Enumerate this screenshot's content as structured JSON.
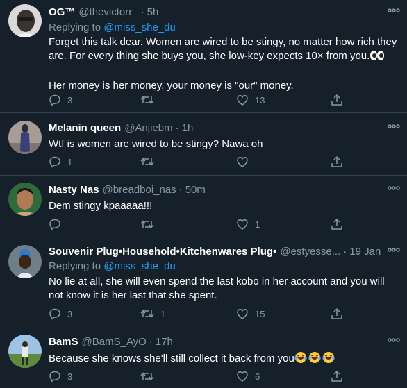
{
  "colors": {
    "background": "#15202b",
    "divider": "#38444d",
    "secondary_text": "#8899a6",
    "link": "#1da1f2",
    "primary_text": "#ffffff"
  },
  "tweets": [
    {
      "name": "OG™",
      "handle": "@thevictorr_",
      "separator": "·",
      "time": "5h",
      "replying_label": "Replying to",
      "replying_to": "@miss_she_du",
      "text": "Forget this talk dear. Women are wired to be stingy, no matter how rich they are. For every thing she buys you, she low-key expects 10× from you.",
      "text_emoji": "eyes-emoji",
      "text2": "Her money is her money, your money is \"our\" money.",
      "replies": "3",
      "retweets": "",
      "likes": "13"
    },
    {
      "name": "Melanin queen",
      "handle": "@Anjiebm",
      "separator": "·",
      "time": "1h",
      "text": "Wtf is women are wired to be stingy? Nawa oh",
      "replies": "1",
      "retweets": "",
      "likes": ""
    },
    {
      "name": "Nasty Nas",
      "handle": "@breadboi_nas",
      "separator": "·",
      "time": "50m",
      "text": "Dem stingy kpaaaaa!!!",
      "replies": "",
      "retweets": "",
      "likes": "1"
    },
    {
      "name": "Souvenir Plug•Household•Kitchenwares Plug•",
      "handle": "@estyesse...",
      "separator": "·",
      "time": "19 Jan",
      "replying_label": "Replying to",
      "replying_to": "@miss_she_du",
      "text": "No lie at all, she will even spend the last kobo in her account and you will not know it is her last that she spent.",
      "replies": "3",
      "retweets": "1",
      "likes": "15"
    },
    {
      "name": "BamS",
      "handle": "@BamS_AyO",
      "separator": "·",
      "time": "17h",
      "text": "Because she knows she'll still collect it back from you",
      "text_emoji": "laughing-tears-emoji x3",
      "replies": "3",
      "retweets": "",
      "likes": "6"
    }
  ]
}
